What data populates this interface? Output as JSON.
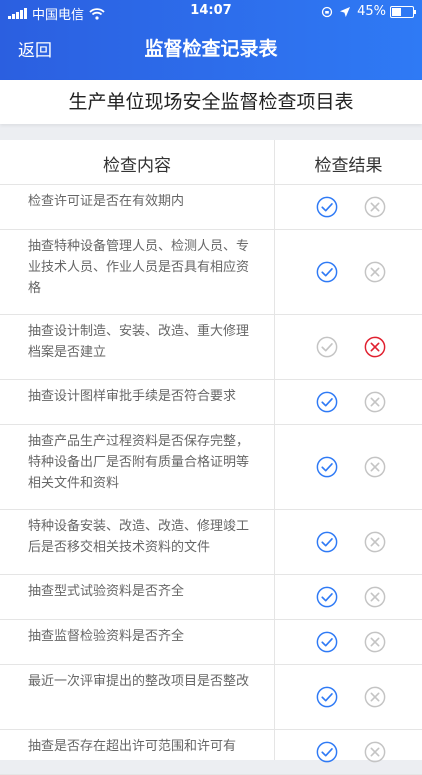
{
  "status_bar": {
    "carrier": "中国电信",
    "time": "14:07",
    "battery": "45%",
    "battery_level": 0.45
  },
  "nav": {
    "back_label": "返回",
    "title": "监督检查记录表"
  },
  "subtitle": "生产单位现场安全监督检查项目表",
  "table": {
    "col_content": "检查内容",
    "col_result": "检查结果",
    "rows": [
      {
        "text": "检查许可证是否在有效期内",
        "result": "pass"
      },
      {
        "text": "抽查特种设备管理人员、检测人员、专业技术人员、作业人员是否具有相应资格",
        "result": "pass"
      },
      {
        "text": "抽查设计制造、安装、改造、重大修理档案是否建立",
        "result": "fail"
      },
      {
        "text": "抽查设计图样审批手续是否符合要求",
        "result": "pass"
      },
      {
        "text": "抽查产品生产过程资料是否保存完整，特种设备出厂是否附有质量合格证明等相关文件和资料",
        "result": "pass"
      },
      {
        "text": "特种设备安装、改造、改造、修理竣工后是否移交相关技术资料的文件",
        "result": "pass"
      },
      {
        "text": "抽查型式试验资料是否齐全",
        "result": "pass"
      },
      {
        "text": "抽查监督检验资料是否齐全",
        "result": "pass"
      },
      {
        "text": "最近一次评审提出的整改项目是否整改",
        "result": "pass"
      },
      {
        "text": "抽查是否存在超出许可范围和许可有",
        "result": "pass"
      }
    ]
  },
  "colors": {
    "accent": "#2f7af5",
    "pass": "#2f7af5",
    "fail": "#e0202f",
    "inactive": "#c4c4c4"
  },
  "icons": {
    "pass": "check-circle-icon",
    "fail": "x-circle-icon"
  }
}
